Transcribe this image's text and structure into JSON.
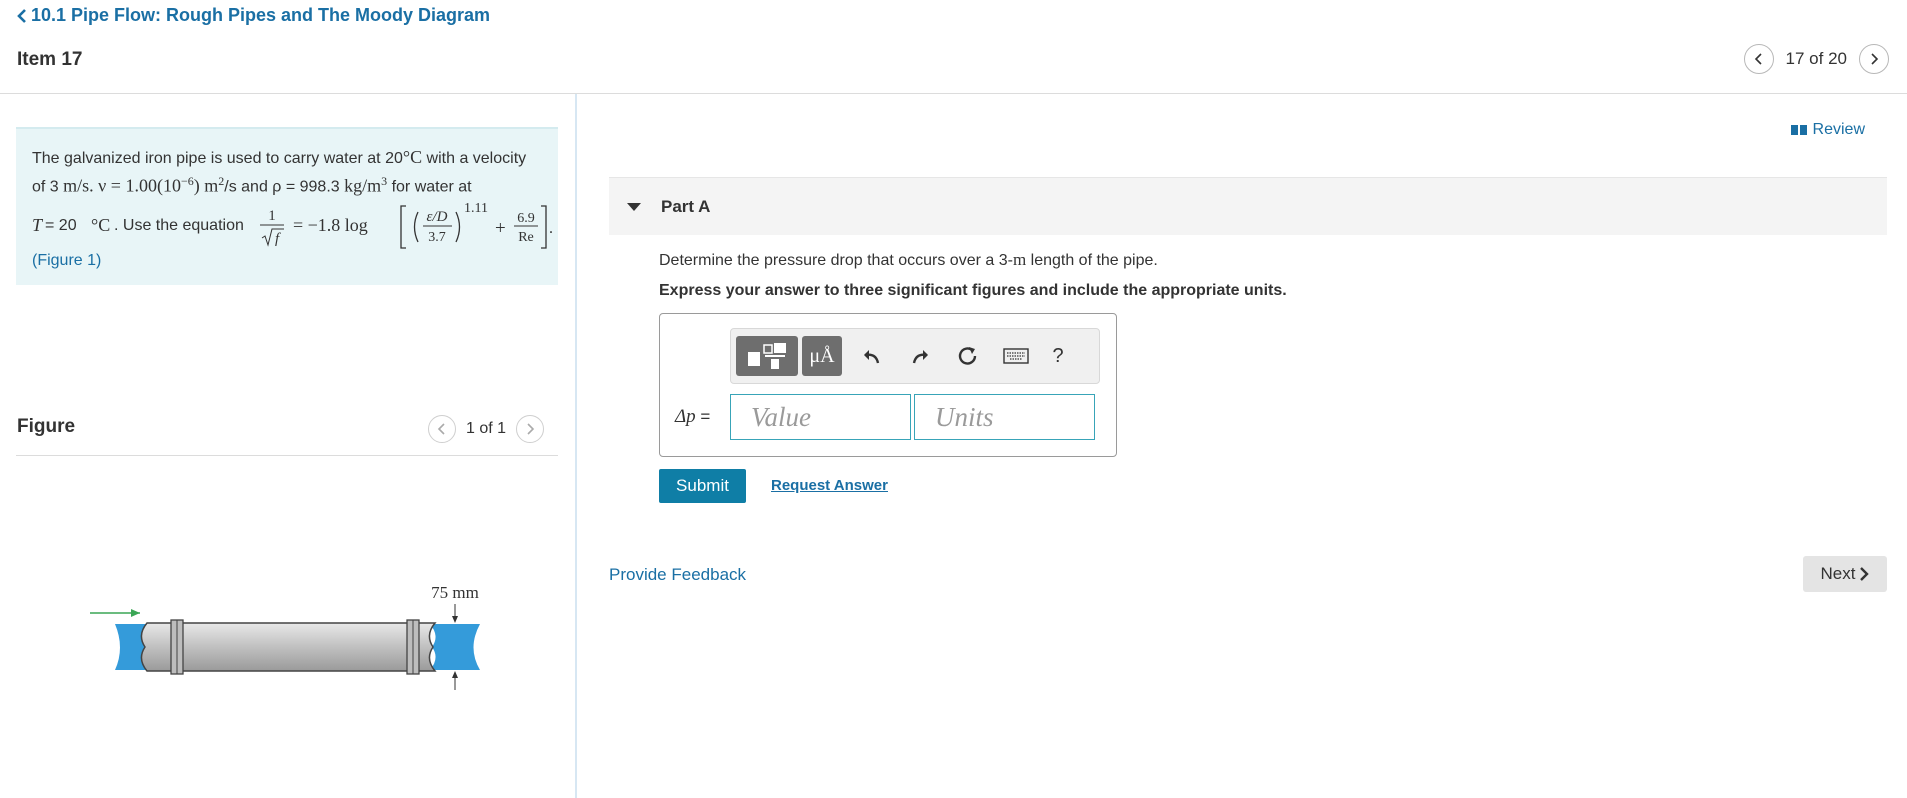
{
  "header": {
    "back_link": "10.1 Pipe Flow: Rough Pipes and The Moody Diagram",
    "item_title": "Item 17",
    "pager": "17 of 20"
  },
  "problem": {
    "line1_text": "The galvanized iron pipe is used to carry water at 20",
    "line1_temp_unit": "°C",
    "line1_end": " with a velocity",
    "line2_a": "of 3 ",
    "line2_vel_unit": "m/s",
    "line2_b": ". ν = 1.00(10",
    "line2_exp": "−6",
    "line2_c": ") ",
    "line2_nu_unit": "m",
    "line2_d": "/s and ρ = 998.3 ",
    "line2_rho_unit": "kg/m",
    "line2_e": " for water at",
    "line3_a": "T",
    "line3_b": " = 20",
    "line3_c": "°C",
    "line3_d": ". Use the equation",
    "eq_one": "1",
    "eq_f": "f",
    "eq_rhs": "= −1.8 log",
    "eq_eps": "ε/D",
    "eq_37": "3.7",
    "eq_exp": "1.11",
    "eq_plus": "+",
    "eq_69": "6.9",
    "eq_re": "Re",
    "figure_link": "(Figure 1)"
  },
  "figure": {
    "title": "Figure",
    "pager": "1 of 1",
    "dimension_label": "75 mm"
  },
  "review_label": "Review",
  "part": {
    "label": "Part A",
    "question_a": "Determine the pressure drop that occurs over a 3-",
    "question_unit": "m",
    "question_b": " length of the pipe.",
    "instruction": "Express your answer to three significant figures and include the appropriate units.",
    "answer_label_symbol": "Δp",
    "answer_label_eq": " =",
    "value_placeholder": "Value",
    "units_placeholder": "Units",
    "toolbar_mu": "μÅ",
    "toolbar_help": "?"
  },
  "buttons": {
    "submit": "Submit",
    "request_answer": "Request Answer",
    "provide_feedback": "Provide Feedback",
    "next": "Next"
  },
  "colors": {
    "link": "#1a6fa4",
    "submit_bg": "#0f7ea6",
    "problem_bg": "#e8f5f7",
    "input_border": "#38a4b8",
    "water": "#1e90d6",
    "arrow": "#3aa655"
  },
  "icons": [
    "chevron-left-icon",
    "chevron-right-icon",
    "book-icon",
    "caret-down-icon",
    "templates-icon",
    "undo-icon",
    "redo-icon",
    "reset-icon",
    "keyboard-icon",
    "help-icon"
  ]
}
